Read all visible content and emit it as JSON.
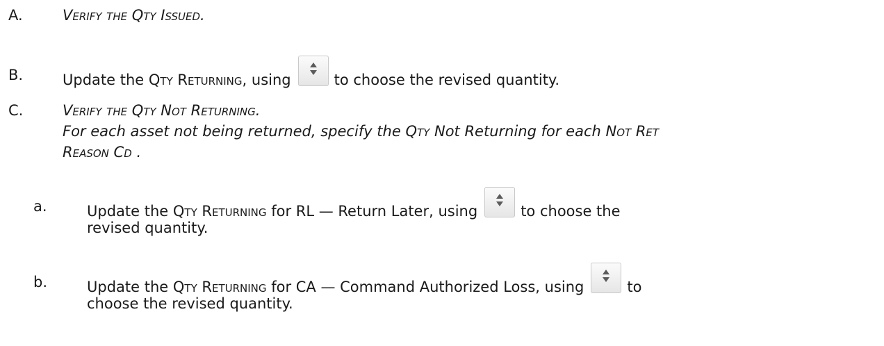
{
  "steps": [
    {
      "marker": "A.",
      "text": "Verify the Qty Issued."
    },
    {
      "marker": "B.",
      "text_before": "Update the ",
      "field": "Qty Returning",
      "text_mid": ", using",
      "icon": "spinner-icon",
      "text_after": "to choose the revised quantity."
    },
    {
      "marker": "C.",
      "line1": "Verify the Qty Not Returning.",
      "line2_start": "For each asset not being returned, specify the ",
      "line2_field": "Qty",
      "line2_end": " Not Returning for each ",
      "line2_field2": "Not Ret",
      "line3": "Reason Cd ."
    }
  ],
  "substeps": [
    {
      "marker": "a.",
      "text_before": "Update the ",
      "field": "Qty Returning",
      "text_mid": " for RL — Return Later, using",
      "icon": "spinner-icon",
      "text_after": "to choose the",
      "line2": "revised quantity."
    },
    {
      "marker": "b.",
      "text_before": "Update the ",
      "field": "Qty Returning",
      "text_mid": " for CA — Command Authorized Loss, using",
      "icon": "spinner-icon",
      "text_after": "to",
      "line2": "choose the revised quantity."
    }
  ]
}
